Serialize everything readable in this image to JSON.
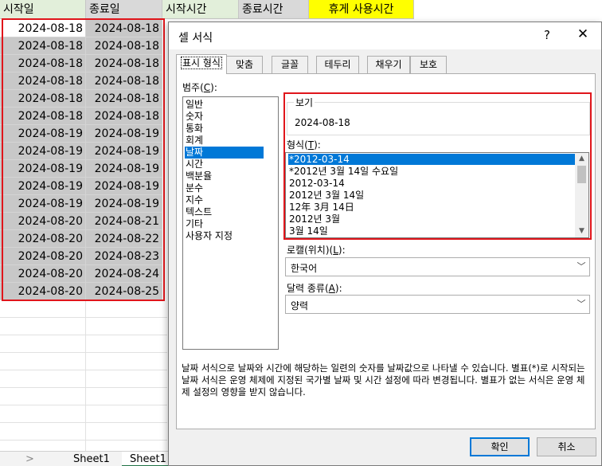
{
  "sheet": {
    "headers": [
      "시작일",
      "종료일",
      "시작시간",
      "종료시간",
      "휴게 사용시간"
    ],
    "header_colors": [
      "#e2efda",
      "#d9d9d9",
      "#e2efda",
      "#d9d9d9",
      "#ffff00"
    ],
    "rows": [
      [
        "2024-08-18",
        "2024-08-18"
      ],
      [
        "2024-08-18",
        "2024-08-18"
      ],
      [
        "2024-08-18",
        "2024-08-18"
      ],
      [
        "2024-08-18",
        "2024-08-18"
      ],
      [
        "2024-08-18",
        "2024-08-18"
      ],
      [
        "2024-08-18",
        "2024-08-18"
      ],
      [
        "2024-08-19",
        "2024-08-19"
      ],
      [
        "2024-08-19",
        "2024-08-19"
      ],
      [
        "2024-08-19",
        "2024-08-19"
      ],
      [
        "2024-08-19",
        "2024-08-19"
      ],
      [
        "2024-08-19",
        "2024-08-19"
      ],
      [
        "2024-08-20",
        "2024-08-21"
      ],
      [
        "2024-08-20",
        "2024-08-22"
      ],
      [
        "2024-08-20",
        "2024-08-23"
      ],
      [
        "2024-08-20",
        "2024-08-24"
      ],
      [
        "2024-08-20",
        "2024-08-25"
      ]
    ],
    "sheet_tabs": [
      "Sheet1",
      "Sheet1"
    ],
    "nav_arrow": ">"
  },
  "dialog": {
    "title": "셀 서식",
    "help": "?",
    "close": "✕",
    "tabs": [
      "표시 형식",
      "맞춤",
      "글꼴",
      "테두리",
      "채우기",
      "보호"
    ],
    "selected_tab": 0,
    "category_label": "범주(",
    "category_key": "C",
    "category_label_end": "):",
    "categories": [
      "일반",
      "숫자",
      "통화",
      "회계",
      "날짜",
      "시간",
      "백분율",
      "분수",
      "지수",
      "텍스트",
      "기타",
      "사용자 지정"
    ],
    "selected_category": 4,
    "sample_label": "보기",
    "sample_value": "2024-08-18",
    "type_label": "형식(",
    "type_key": "T",
    "type_label_end": "):",
    "types": [
      "*2012-03-14",
      "*2012년 3월 14일 수요일",
      "2012-03-14",
      "2012년 3월 14일",
      "12年 3月 14日",
      "2012년 3월",
      "3월 14일"
    ],
    "selected_type": 0,
    "locale_label": "로캘(위치)(",
    "locale_key": "L",
    "locale_label_end": "):",
    "locale_value": "한국어",
    "calendar_label": "달력 종류(",
    "calendar_key": "A",
    "calendar_label_end": "):",
    "calendar_value": "양력",
    "description": "날짜 서식으로 날짜와 시간에 해당하는 일련의 숫자를 날짜값으로 나타낼 수 있습니다. 별표(*)로 시작되는 날짜 서식은 운영 체제에 지정된 국가별 날짜 및 시간 설정에 따라 변경됩니다. 별표가 없는 서식은 운영 체제 설정의 영향을 받지 않습니다.",
    "ok_label": "확인",
    "cancel_label": "취소"
  },
  "colors": {
    "highlight_red": "#e0151b",
    "selection_blue": "#0078d7",
    "selected_cell_gray": "#c8c8c8"
  }
}
